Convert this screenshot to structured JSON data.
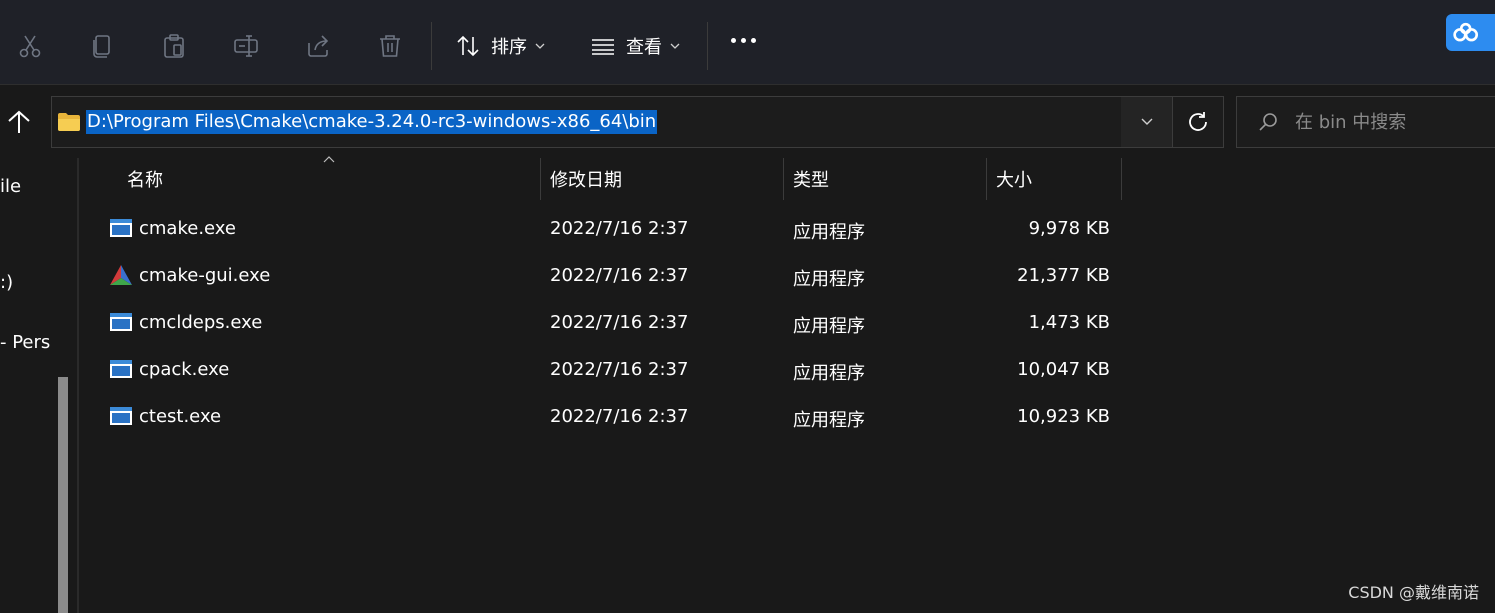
{
  "toolbar": {
    "sort_label": "排序",
    "view_label": "查看",
    "icons": [
      "cut-icon",
      "copy-icon",
      "paste-icon",
      "rename-icon",
      "share-icon",
      "delete-icon",
      "sort-icon",
      "view-icon",
      "more-icon"
    ]
  },
  "address": {
    "path": "D:\\Program Files\\Cmake\\cmake-3.24.0-rc3-windows-x86_64\\bin"
  },
  "search": {
    "placeholder": "在 bin 中搜索"
  },
  "nav": {
    "items": [
      {
        "label": "ile"
      },
      {
        "label": ":)"
      },
      {
        "label": " - Pers"
      }
    ]
  },
  "columns": {
    "name": "名称",
    "date": "修改日期",
    "type": "类型",
    "size": "大小"
  },
  "files": [
    {
      "name": "cmake.exe",
      "date": "2022/7/16 2:37",
      "type": "应用程序",
      "size": "9,978 KB",
      "icon": "exe-icon"
    },
    {
      "name": "cmake-gui.exe",
      "date": "2022/7/16 2:37",
      "type": "应用程序",
      "size": "21,377 KB",
      "icon": "cmake-gui-icon"
    },
    {
      "name": "cmcldeps.exe",
      "date": "2022/7/16 2:37",
      "type": "应用程序",
      "size": "1,473 KB",
      "icon": "exe-icon"
    },
    {
      "name": "cpack.exe",
      "date": "2022/7/16 2:37",
      "type": "应用程序",
      "size": "10,047 KB",
      "icon": "exe-icon"
    },
    {
      "name": "ctest.exe",
      "date": "2022/7/16 2:37",
      "type": "应用程序",
      "size": "10,923 KB",
      "icon": "exe-icon"
    }
  ],
  "watermark": "CSDN @戴维南诺",
  "colors": {
    "background": "#191919",
    "toolbar": "#1f2128",
    "selection": "#0a64c6",
    "folder": "#f0c040",
    "badge": "#2d8cf0"
  }
}
